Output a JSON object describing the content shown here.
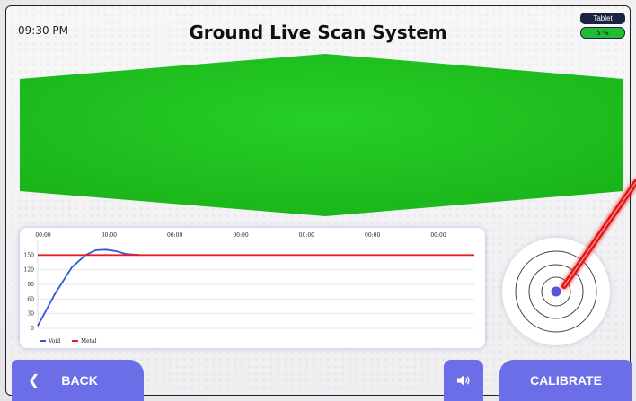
{
  "header": {
    "time": "09:30 PM",
    "title": "Ground Live Scan System",
    "device_label": "Tablet",
    "battery_text": "5 %"
  },
  "colors": {
    "accent": "#6b6ee6",
    "scan_green": "#22c322",
    "void_line": "#3357e0",
    "metal_line": "#e02020"
  },
  "chart_data": {
    "type": "line",
    "x_tick_labels": [
      "00:00",
      "00:00",
      "00:00",
      "00:00",
      "00:00",
      "00:00",
      "00:00"
    ],
    "y_ticks": [
      0,
      30,
      60,
      90,
      120,
      150
    ],
    "ylim": [
      0,
      180
    ],
    "grid": true,
    "legend_position": "bottom-left",
    "series": [
      {
        "name": "Void",
        "color": "#3357e0",
        "x": [
          0,
          0.25,
          0.5,
          0.7,
          0.85,
          1.0,
          1.15,
          1.3,
          1.5
        ],
        "y": [
          5,
          70,
          125,
          150,
          160,
          161,
          158,
          152,
          150
        ]
      },
      {
        "name": "Metal",
        "color": "#e02020",
        "x": [
          0,
          6.4
        ],
        "y": [
          150,
          150
        ]
      }
    ],
    "xlim": [
      0,
      6.4
    ]
  },
  "buttons": {
    "back": "BACK",
    "calibrate": "CALIBRATE",
    "back_icon": "chevron-left-icon",
    "sound_icon": "speaker-icon"
  }
}
